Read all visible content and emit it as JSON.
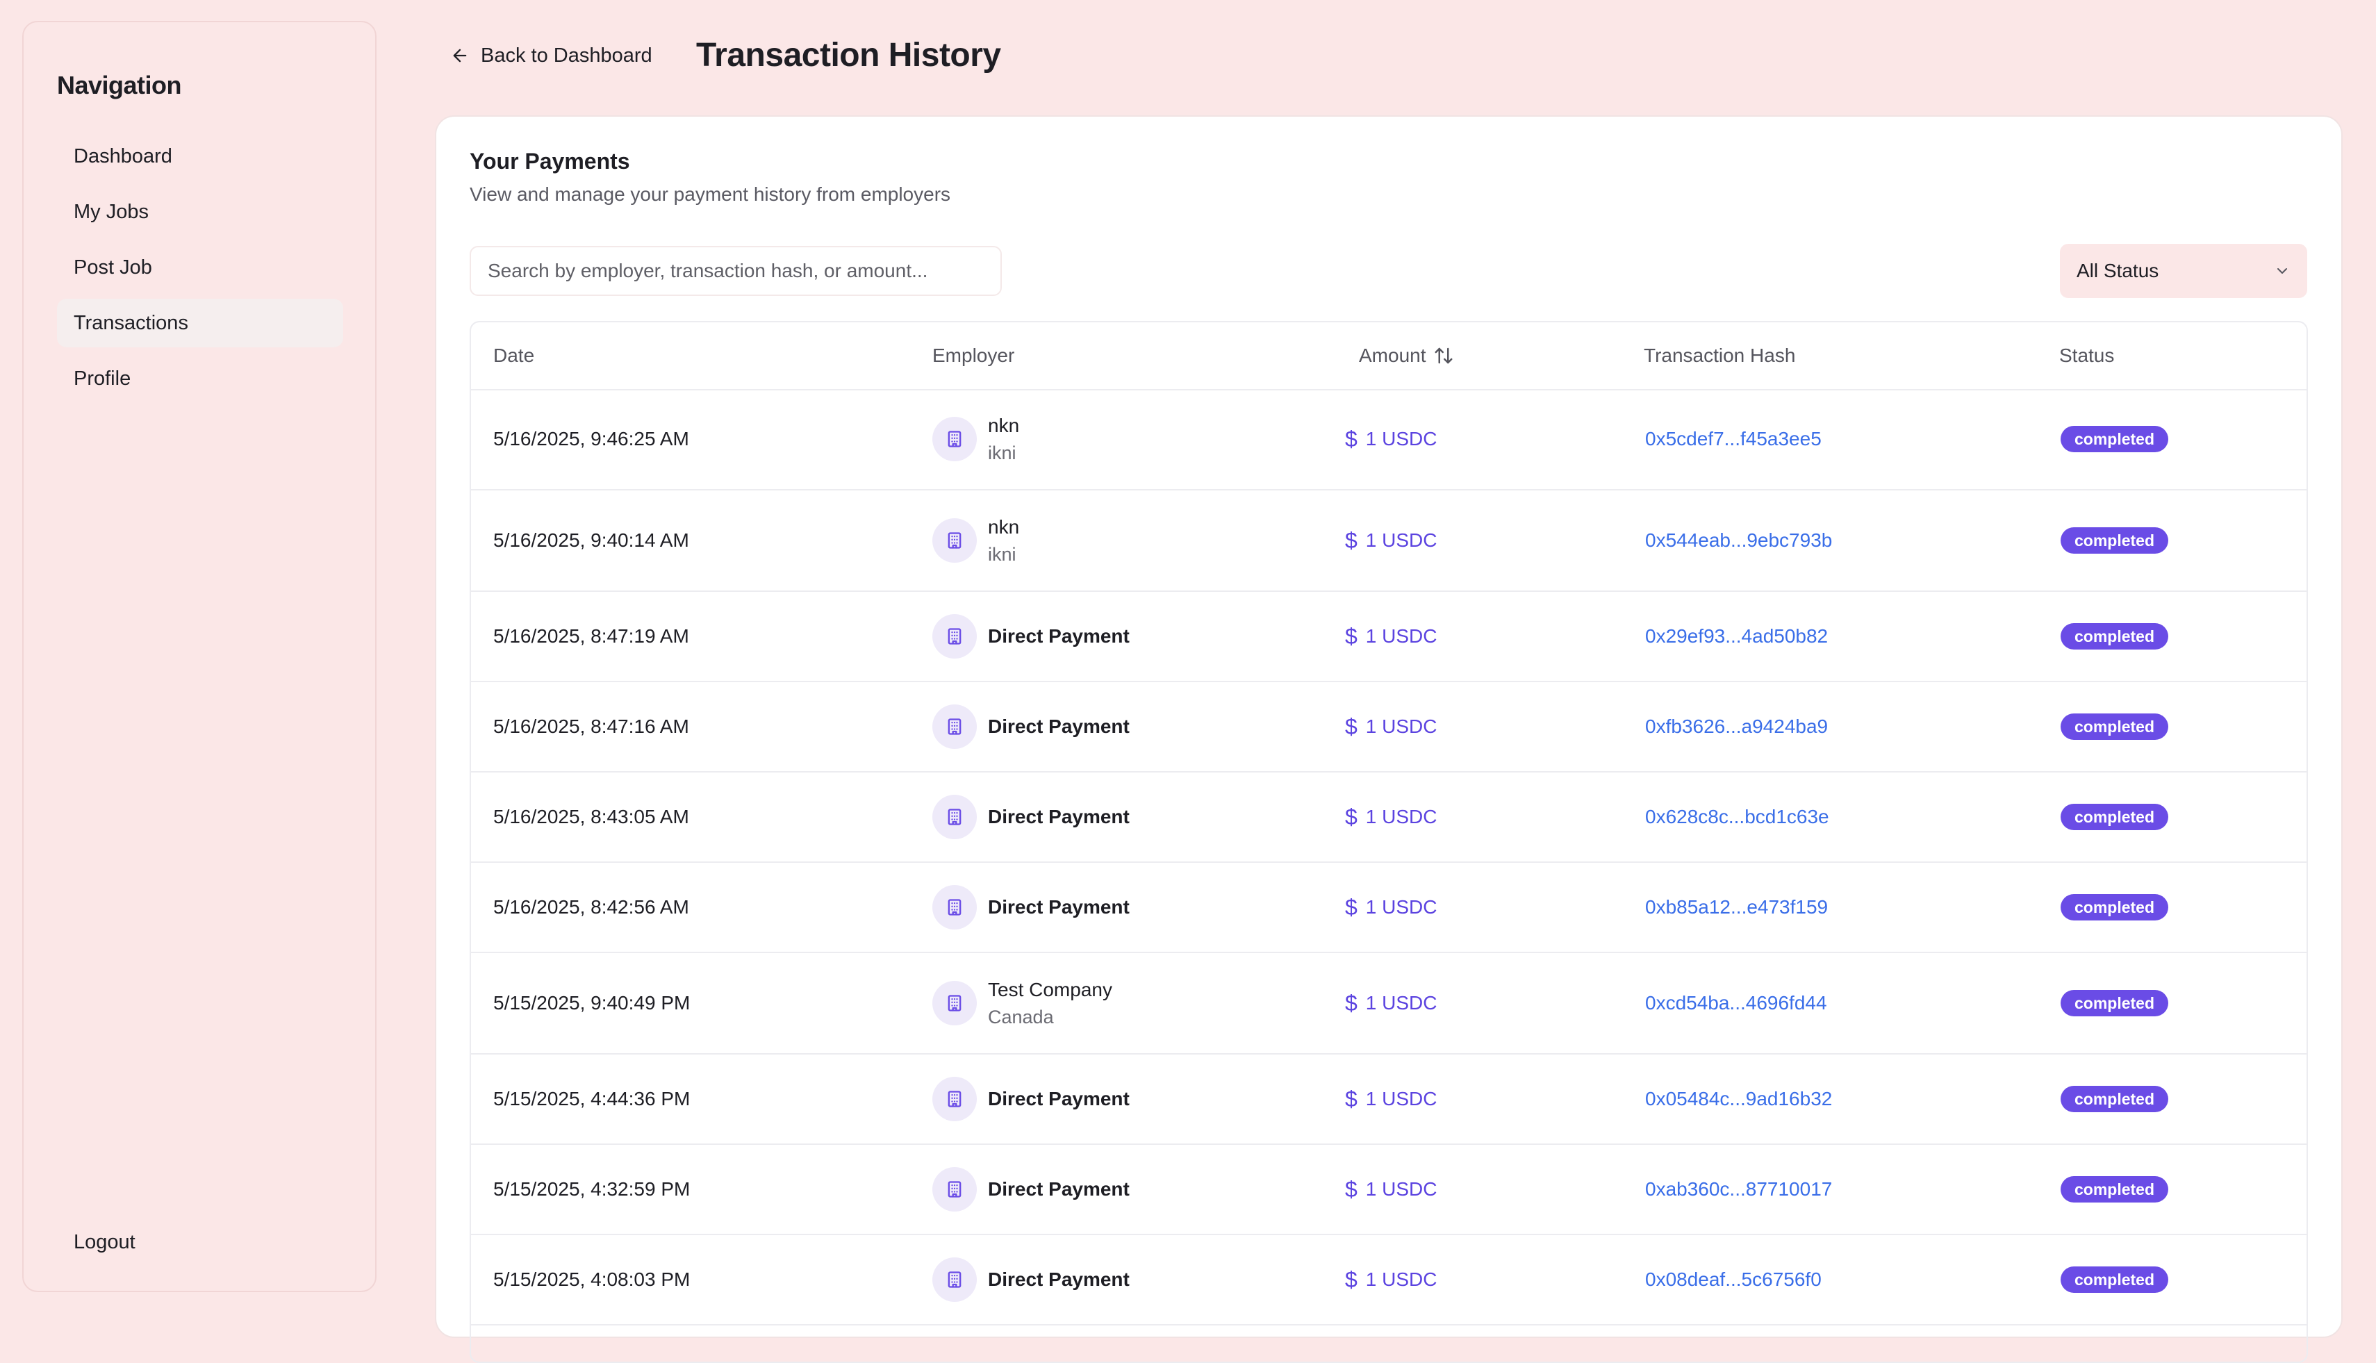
{
  "sidebar": {
    "title": "Navigation",
    "items": [
      {
        "label": "Dashboard",
        "active": false
      },
      {
        "label": "My Jobs",
        "active": false
      },
      {
        "label": "Post Job",
        "active": false
      },
      {
        "label": "Transactions",
        "active": true
      },
      {
        "label": "Profile",
        "active": false
      }
    ],
    "logout_label": "Logout"
  },
  "header": {
    "back_label": "Back to Dashboard",
    "title": "Transaction History"
  },
  "card": {
    "title": "Your Payments",
    "subtitle": "View and manage your payment history from employers",
    "search_placeholder": "Search by employer, transaction hash, or amount...",
    "status_filter": "All Status"
  },
  "table": {
    "columns": [
      "Date",
      "Employer",
      "Amount",
      "Transaction Hash",
      "Status"
    ],
    "rows": [
      {
        "date": "5/16/2025, 9:46:25 AM",
        "employer": "nkn",
        "employer_sub": "ikni",
        "amount": "1 USDC",
        "hash": "0x5cdef7...f45a3ee5",
        "status": "completed"
      },
      {
        "date": "5/16/2025, 9:40:14 AM",
        "employer": "nkn",
        "employer_sub": "ikni",
        "amount": "1 USDC",
        "hash": "0x544eab...9ebc793b",
        "status": "completed"
      },
      {
        "date": "5/16/2025, 8:47:19 AM",
        "employer": "Direct Payment",
        "employer_sub": "",
        "amount": "1 USDC",
        "hash": "0x29ef93...4ad50b82",
        "status": "completed"
      },
      {
        "date": "5/16/2025, 8:47:16 AM",
        "employer": "Direct Payment",
        "employer_sub": "",
        "amount": "1 USDC",
        "hash": "0xfb3626...a9424ba9",
        "status": "completed"
      },
      {
        "date": "5/16/2025, 8:43:05 AM",
        "employer": "Direct Payment",
        "employer_sub": "",
        "amount": "1 USDC",
        "hash": "0x628c8c...bcd1c63e",
        "status": "completed"
      },
      {
        "date": "5/16/2025, 8:42:56 AM",
        "employer": "Direct Payment",
        "employer_sub": "",
        "amount": "1 USDC",
        "hash": "0xb85a12...e473f159",
        "status": "completed"
      },
      {
        "date": "5/15/2025, 9:40:49 PM",
        "employer": "Test Company",
        "employer_sub": "Canada",
        "amount": "1 USDC",
        "hash": "0xcd54ba...4696fd44",
        "status": "completed"
      },
      {
        "date": "5/15/2025, 4:44:36 PM",
        "employer": "Direct Payment",
        "employer_sub": "",
        "amount": "1 USDC",
        "hash": "0x05484c...9ad16b32",
        "status": "completed"
      },
      {
        "date": "5/15/2025, 4:32:59 PM",
        "employer": "Direct Payment",
        "employer_sub": "",
        "amount": "1 USDC",
        "hash": "0xab360c...87710017",
        "status": "completed"
      },
      {
        "date": "5/15/2025, 4:08:03 PM",
        "employer": "Direct Payment",
        "employer_sub": "",
        "amount": "1 USDC",
        "hash": "0x08deaf...5c6756f0",
        "status": "completed"
      }
    ]
  },
  "icons": {
    "back": "arrow-left-icon",
    "sort": "sort-arrows-icon",
    "dropdown": "chevron-down-icon",
    "employer": "building-icon",
    "amount": "dollar-icon"
  },
  "colors": {
    "background": "#fbe7e7",
    "accent": "#6a4ce6",
    "amount": "#5b43e0",
    "link": "#3a6ee8"
  }
}
